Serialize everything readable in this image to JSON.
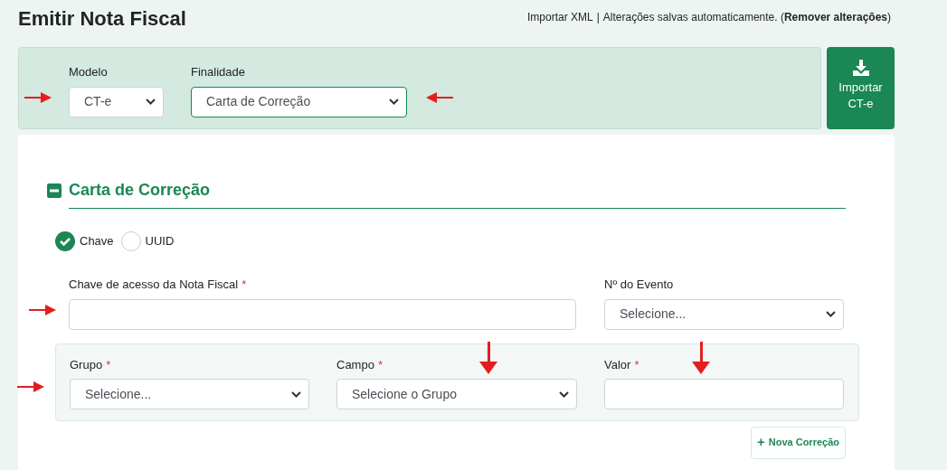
{
  "header": {
    "title": "Emitir Nota Fiscal",
    "import_link": "Importar XML",
    "separator": "|",
    "status": "Alterações salvas automaticamente. (",
    "remove_link": "Remover alterações",
    "status_end": ")"
  },
  "top_panel": {
    "fields": [
      {
        "label": "Modelo",
        "value": "CT-e",
        "focused": false
      },
      {
        "label": "Finalidade",
        "value": "Carta de Correção",
        "focused": true
      }
    ],
    "import_button": {
      "label": "Importar CT-e"
    }
  },
  "section": {
    "title": "Carta de Correção",
    "expanded": true,
    "key_type": [
      {
        "label": "Chave",
        "selected": true
      },
      {
        "label": "UUID",
        "selected": false
      }
    ],
    "access_key": {
      "label": "Chave de acesso da Nota Fiscal",
      "required_mark": "*"
    },
    "event": {
      "label": "Nº do Evento",
      "value": "Selecione..."
    },
    "correction": {
      "group": {
        "label": "Grupo",
        "required_mark": "*",
        "value": "Selecione..."
      },
      "field": {
        "label": "Campo",
        "required_mark": "*",
        "value": "Selecione o Grupo"
      },
      "value": {
        "label": "Valor",
        "required_mark": "*"
      }
    },
    "add_button": {
      "icon": "+",
      "label": "Nova Correção"
    }
  }
}
